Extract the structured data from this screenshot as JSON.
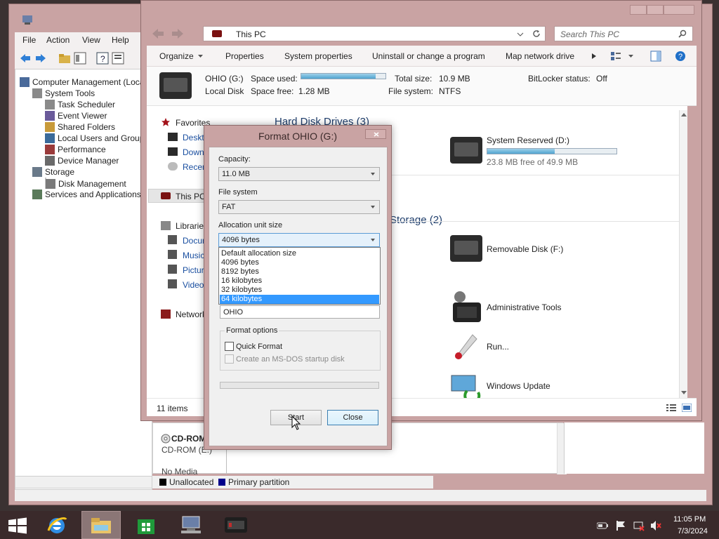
{
  "computer_management": {
    "menu": [
      "File",
      "Action",
      "View",
      "Help"
    ],
    "tree": [
      {
        "label": "Computer Management (Loca",
        "indent": 0
      },
      {
        "label": "System Tools",
        "indent": 1
      },
      {
        "label": "Task Scheduler",
        "indent": 2
      },
      {
        "label": "Event Viewer",
        "indent": 2
      },
      {
        "label": "Shared Folders",
        "indent": 2
      },
      {
        "label": "Local Users and Group",
        "indent": 2
      },
      {
        "label": "Performance",
        "indent": 2
      },
      {
        "label": "Device Manager",
        "indent": 2
      },
      {
        "label": "Storage",
        "indent": 1
      },
      {
        "label": "Disk Management",
        "indent": 2
      },
      {
        "label": "Services and Applications",
        "indent": 1
      }
    ],
    "bottom": {
      "cdrom_title": "CD-ROM",
      "cdrom_sub": "CD-ROM (E:)",
      "no_media": "No Media",
      "legend_unallocated": "Unallocated",
      "legend_primary": "Primary partition"
    }
  },
  "explorer": {
    "address": "This PC",
    "search_placeholder": "Search This PC",
    "commands": [
      "Organize",
      "Properties",
      "System properties",
      "Uninstall or change a program",
      "Map network drive"
    ],
    "details": {
      "name": "OHIO (G:)",
      "type": "Local Disk",
      "space_used_label": "Space used:",
      "space_free_label": "Space free:",
      "space_free": "1.28 MB",
      "total_size_label": "Total size:",
      "total_size": "10.9 MB",
      "file_system_label": "File system:",
      "file_system": "NTFS",
      "bitlocker_label": "BitLocker status:",
      "bitlocker": "Off",
      "used_fraction": 0.88
    },
    "nav": {
      "favorites": "Favorites",
      "desktop": "Deskto",
      "downloads": "Downl",
      "recent": "Recent",
      "this_pc": "This PC",
      "libraries": "Libraries",
      "documents": "Docun",
      "music": "Music",
      "pictures": "Picture",
      "videos": "Videos",
      "network": "Network"
    },
    "sections": {
      "hard_disk": "Hard Disk Drives (3)",
      "removable": "Storage (2)"
    },
    "items": {
      "system_reserved": "System Reserved (D:)",
      "system_reserved_free": "23.8 MB free of 49.9 MB",
      "system_reserved_fraction": 0.52,
      "removable": "Removable Disk (F:)",
      "admin_tools": "Administrative Tools",
      "run": "Run...",
      "windows_update": "Windows Update"
    },
    "status_count": "11 items",
    "status_extra": "1"
  },
  "dialog": {
    "title": "Format OHIO (G:)",
    "capacity_label": "Capacity:",
    "capacity_value": "11.0 MB",
    "fs_label": "File system",
    "fs_value": "FAT",
    "alloc_label": "Allocation unit size",
    "alloc_value": "4096 bytes",
    "alloc_options": [
      "Default allocation size",
      "4096 bytes",
      "8192 bytes",
      "16 kilobytes",
      "32 kilobytes",
      "64 kilobytes"
    ],
    "alloc_highlight_index": 5,
    "volume_label_value": "OHIO",
    "format_options_label": "Format options",
    "quick_format": "Quick Format",
    "msdos": "Create an MS-DOS startup disk",
    "start": "Start",
    "close": "Close"
  },
  "taskbar": {
    "time": "11:05 PM",
    "date": "7/3/2024"
  },
  "colors": {
    "window_frame": "#c9a3a3",
    "highlight": "#3399ff",
    "taskbar": "#3a2a2b"
  }
}
